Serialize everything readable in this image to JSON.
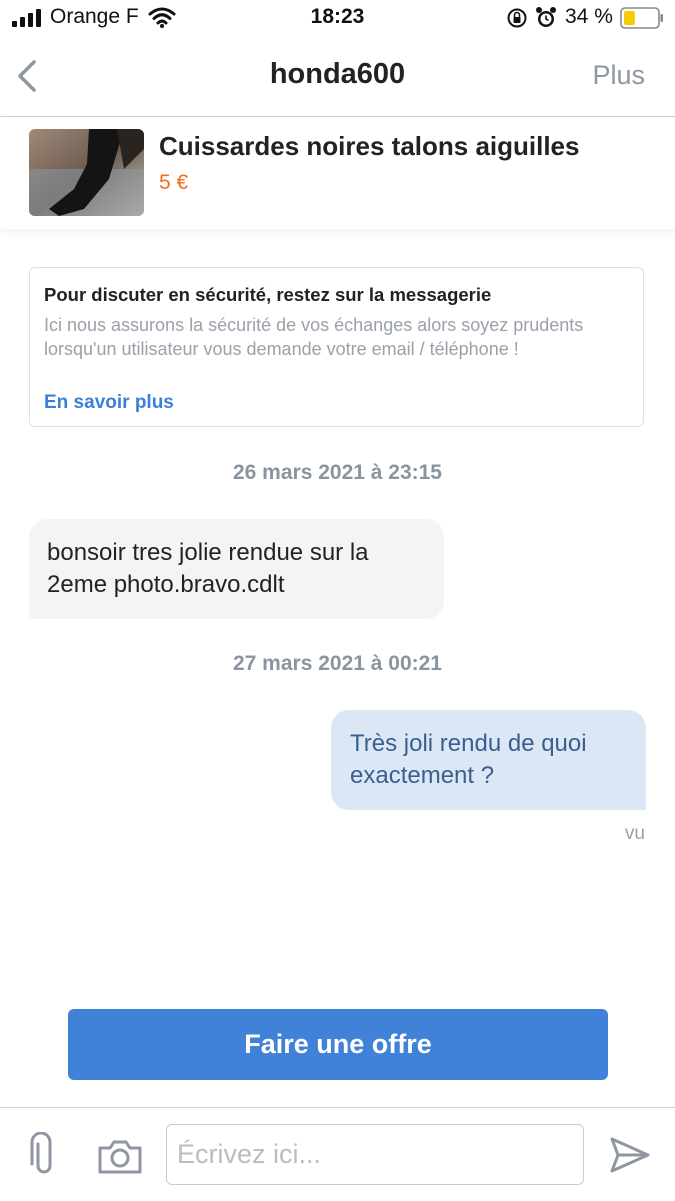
{
  "status_bar": {
    "carrier": "Orange F",
    "time": "18:23",
    "battery_pct": "34 %",
    "battery_level": 0.34,
    "icons": [
      "signal-icon",
      "wifi-icon",
      "rotation-lock-icon",
      "alarm-icon",
      "battery-icon"
    ]
  },
  "nav": {
    "back_icon": "chevron-left-icon",
    "title": "honda600",
    "more_label": "Plus"
  },
  "listing": {
    "title": "Cuissardes noires talons aiguilles",
    "price": "5 €",
    "price_color": "#f36b1c"
  },
  "notice": {
    "title": "Pour discuter en sécurité, restez sur la messagerie",
    "body": "Ici nous assurons la sécurité de vos échanges alors soyez prudents lorsqu'un utilisateur vous demande votre email / téléphone !",
    "link": "En savoir plus"
  },
  "messages": [
    {
      "date": "26 mars 2021 à 23:15",
      "direction": "incoming",
      "text": "bonsoir tres jolie rendue sur la 2eme photo.bravo.cdlt"
    },
    {
      "date": "27 mars 2021 à 00:21",
      "direction": "outgoing",
      "text": "Très joli rendu de quoi exactement ?",
      "status": "vu"
    }
  ],
  "offer_button": "Faire une offre",
  "composer": {
    "placeholder": "Écrivez ici...",
    "icons": [
      "paperclip-icon",
      "camera-icon",
      "send-icon"
    ]
  },
  "colors": {
    "accent": "#3f82d8",
    "link": "#3a80d6",
    "outgoing_bubble": "#dce7f6",
    "incoming_bubble": "#f3f4f6"
  }
}
